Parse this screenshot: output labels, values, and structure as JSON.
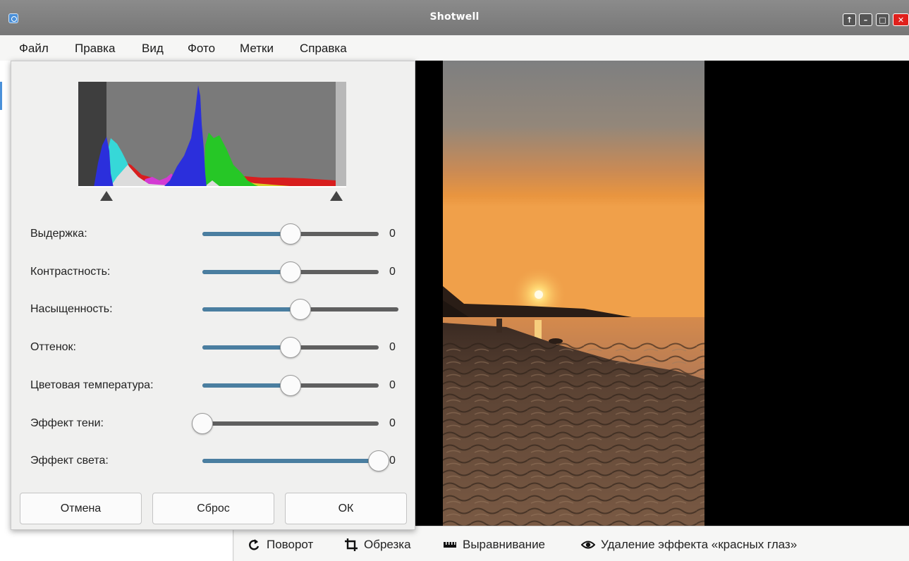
{
  "window": {
    "title": "Shotwell"
  },
  "menu": [
    "Файл",
    "Правка",
    "Вид",
    "Фото",
    "Метки",
    "Справка"
  ],
  "adjust": {
    "sliders": [
      {
        "label": "Выдержка:",
        "value": "0",
        "level": 0.5
      },
      {
        "label": "Контрастность:",
        "value": "0",
        "level": 0.5
      },
      {
        "label": "Насыщенность:",
        "value": "",
        "level": 0.5
      },
      {
        "label": "Оттенок:",
        "value": "0",
        "level": 0.5
      },
      {
        "label": "Цветовая температура:",
        "value": "0",
        "level": 0.5
      },
      {
        "label": "Эффект тени:",
        "value": "0",
        "level": 0.0
      },
      {
        "label": "Эффект света:",
        "value": "0",
        "level": 1.0
      }
    ],
    "buttons": {
      "cancel": "Отмена",
      "reset": "Сброс",
      "ok": "ОК"
    }
  },
  "toolbar": {
    "rotate": "Поворот",
    "crop": "Обрезка",
    "straighten": "Выравнивание",
    "redeye": "Удаление эффекта «красных глаз»"
  },
  "icons": {
    "rotate": "rotate-icon",
    "crop": "crop-icon",
    "straighten": "ruler-icon",
    "redeye": "eye-icon"
  },
  "colors": {
    "slider_fill": "#4a7ea0",
    "title_bar": "#7f7f7f",
    "close": "#e0201c"
  }
}
